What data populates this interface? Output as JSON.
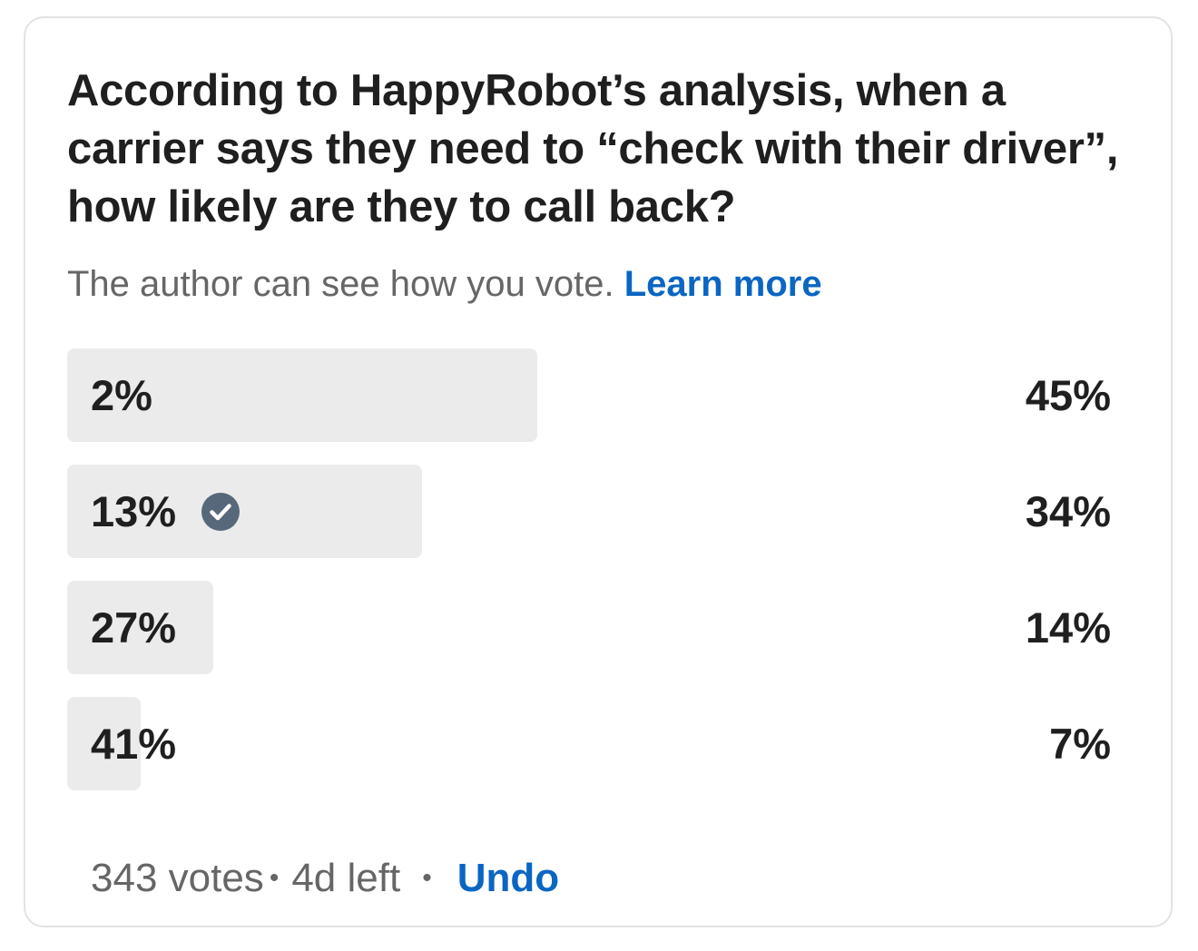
{
  "poll": {
    "question": "According to HappyRobot’s analysis, when a carrier says they need to “check with their driver”, how likely are they to call back?",
    "notice_text": "The author can see how you vote.",
    "learn_more": "Learn more",
    "options": [
      {
        "label": "2%",
        "result": "45%",
        "share": 45,
        "selected": false
      },
      {
        "label": "13%",
        "result": "34%",
        "share": 34,
        "selected": true
      },
      {
        "label": "27%",
        "result": "14%",
        "share": 14,
        "selected": false
      },
      {
        "label": "41%",
        "result": "7%",
        "share": 7,
        "selected": false
      }
    ],
    "votes": "343 votes",
    "separator": "•",
    "time_left": "4d left",
    "undo": "Undo",
    "selected_icon": "check-circle-icon"
  },
  "colors": {
    "accent": "#0a66c2",
    "bar_fill": "#ebebeb",
    "check_icon": "#56687a"
  }
}
